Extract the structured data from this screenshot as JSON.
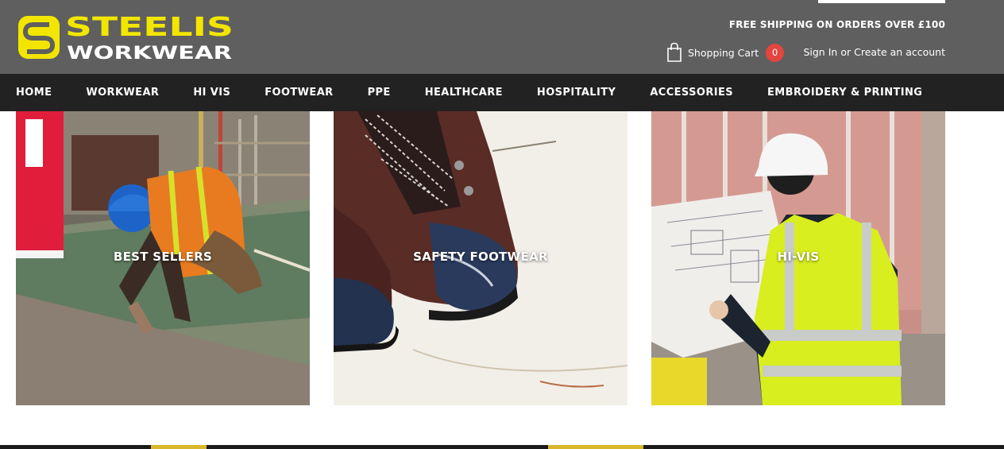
{
  "header": {
    "brand_top": "STEELIS",
    "brand_bottom": "WORKWEAR",
    "shipping_notice": "FREE SHIPPING ON ORDERS OVER £100",
    "cart_label": "Shopping Cart",
    "cart_count": "0",
    "sign_in": "Sign In",
    "or_text": "or",
    "create_account": "Create an account",
    "background_color": "#5f5f5f",
    "brand_color": "#f2e600"
  },
  "nav": {
    "items": [
      {
        "label": "HOME"
      },
      {
        "label": "WORKWEAR"
      },
      {
        "label": "HI VIS"
      },
      {
        "label": "FOOTWEAR"
      },
      {
        "label": "PPE"
      },
      {
        "label": "HEALTHCARE"
      },
      {
        "label": "HOSPITALITY"
      },
      {
        "label": "ACCESSORIES"
      },
      {
        "label": "EMBROIDERY & PRINTING"
      }
    ],
    "background_color": "#222222"
  },
  "tiles": [
    {
      "label": "BEST SELLERS"
    },
    {
      "label": "SAFETY FOOTWEAR"
    },
    {
      "label": "HI-VIS"
    }
  ],
  "icons": {
    "cart": "shopping-bag-icon",
    "cart_badge_color": "#e3453f"
  }
}
